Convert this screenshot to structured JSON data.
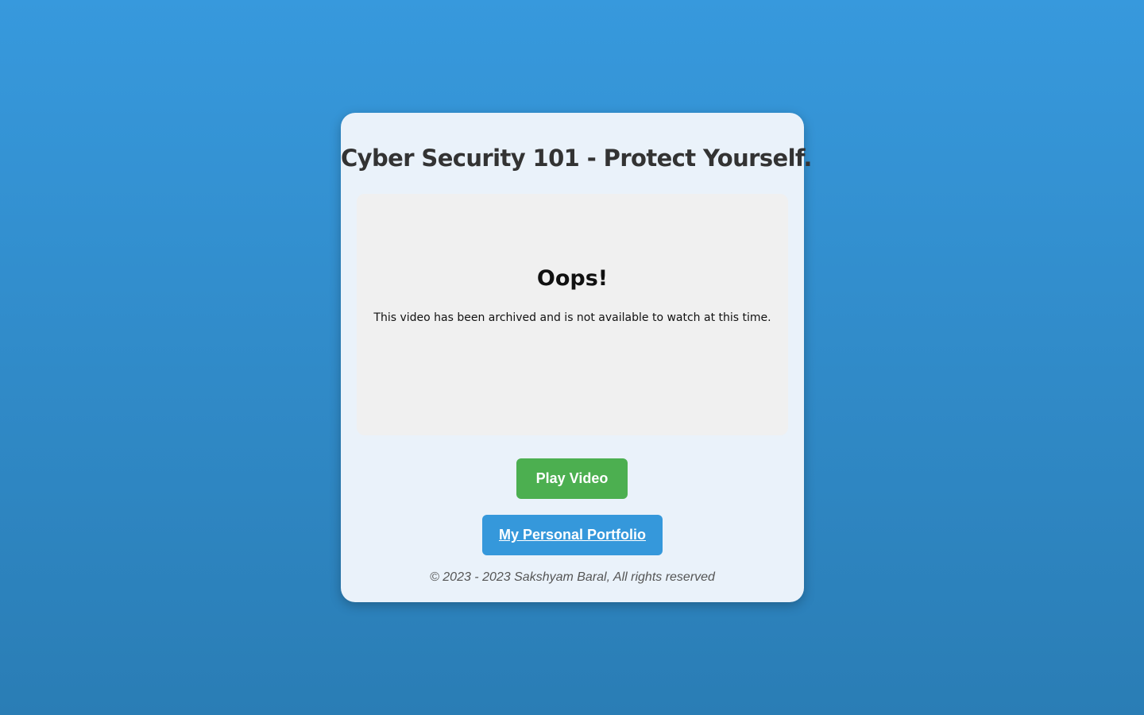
{
  "page": {
    "title": "Cyber Security 101 - Protect Yourself."
  },
  "video": {
    "heading": "Oops!",
    "message": "This video has been archived and is not available to watch at this time."
  },
  "actions": {
    "play_label": "Play Video",
    "portfolio_label": "My Personal Portfolio"
  },
  "footer": {
    "copyright": "© 2023 - 2023 Sakshyam Baral, All rights reserved"
  },
  "colors": {
    "background_top": "#3799dd",
    "background_bottom": "#2a7db5",
    "card": "#eaf2fa",
    "play_button": "#4caf50",
    "portfolio_button": "#3598db"
  }
}
